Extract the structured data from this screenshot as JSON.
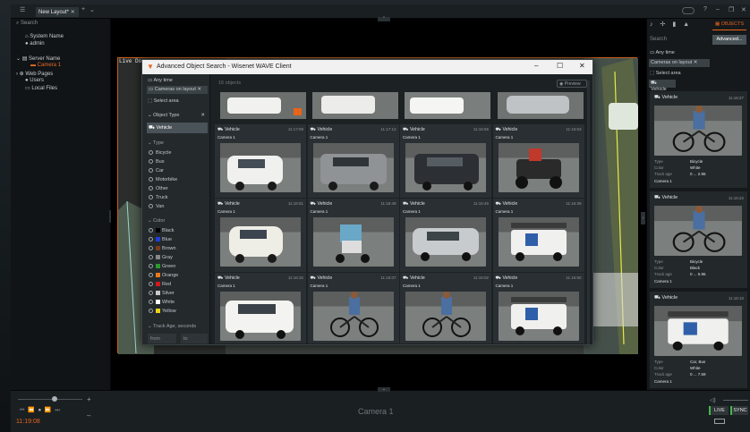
{
  "titlebar": {
    "tab_label": "New Layout*"
  },
  "tree": {
    "search_placeholder": "Search",
    "system_name": "System Name",
    "user": "admin",
    "server": "Server Name",
    "camera": "Camera 1",
    "web_pages": "Web Pages",
    "users": "Users",
    "local_files": "Local Files"
  },
  "scene": {
    "camera_label": "Live Do"
  },
  "dialog": {
    "title": "Advanced Object Search - Wisenet WAVE Client",
    "count": "16 objects",
    "preview": "Preview",
    "filters": {
      "any_time": "Any time",
      "cameras": "Cameras on layout",
      "select_area": "Select area",
      "object_type": "Object Type",
      "vehicle": "Vehicle",
      "type_heading": "Type",
      "types": [
        "Bicycle",
        "Bus",
        "Car",
        "Motorbike",
        "Other",
        "Truck",
        "Van"
      ],
      "color_heading": "Color",
      "colors": [
        {
          "label": "Black",
          "hex": "#000000"
        },
        {
          "label": "Blue",
          "hex": "#1f3fd6"
        },
        {
          "label": "Brown",
          "hex": "#7a3a1c"
        },
        {
          "label": "Gray",
          "hex": "#888888"
        },
        {
          "label": "Green",
          "hex": "#2a9a30"
        },
        {
          "label": "Orange",
          "hex": "#e87a1a"
        },
        {
          "label": "Red",
          "hex": "#d21a1a"
        },
        {
          "label": "Silver",
          "hex": "#c9c9c9"
        },
        {
          "label": "White",
          "hex": "#ffffff"
        },
        {
          "label": "Yellow",
          "hex": "#e8d21a"
        }
      ],
      "track_age": "Track Age, seconds",
      "from": "from",
      "to": "to"
    },
    "results": [
      {
        "label": "Vehicle",
        "time": "11:17:09",
        "camera": "Camera 1",
        "kind": "white-car"
      },
      {
        "label": "Vehicle",
        "time": "11:17:13",
        "camera": "Camera 1",
        "kind": "gray-suv"
      },
      {
        "label": "Vehicle",
        "time": "11:16:55",
        "camera": "Camera 1",
        "kind": "black-suv"
      },
      {
        "label": "Vehicle",
        "time": "11:16:53",
        "camera": "Camera 1",
        "kind": "atv"
      },
      {
        "label": "Vehicle",
        "time": "11:16:51",
        "camera": "Camera 1",
        "kind": "white-small-car"
      },
      {
        "label": "Vehicle",
        "time": "11:16:49",
        "camera": "Camera 1",
        "kind": "scooter"
      },
      {
        "label": "Vehicle",
        "time": "11:16:45",
        "camera": "Camera 1",
        "kind": "silver-car"
      },
      {
        "label": "Vehicle",
        "time": "11:16:39",
        "camera": "Camera 1",
        "kind": "cart"
      },
      {
        "label": "Vehicle",
        "time": "11:16:32",
        "camera": "Camera 1",
        "kind": "white-suv"
      },
      {
        "label": "Vehicle",
        "time": "11:16:07",
        "camera": "Camera 1",
        "kind": "bicycle"
      },
      {
        "label": "Vehicle",
        "time": "11:16:02",
        "camera": "Camera 1",
        "kind": "bicycle"
      },
      {
        "label": "Vehicle",
        "time": "11:15:50",
        "camera": "Camera 1",
        "kind": "cart"
      }
    ]
  },
  "right_panel": {
    "tab_objects": "OBJECTS",
    "search_placeholder": "Search",
    "advanced": "Advanced...",
    "any_time": "Any time",
    "cameras": "Cameras on layout",
    "select_area": "Select area",
    "filter_chip": "Vehicle",
    "cards": [
      {
        "label": "Vehicle",
        "time": "11:16:27",
        "type_key": "Type",
        "type": "Bicycle",
        "color_key": "Color",
        "color": "White",
        "age_key": "Track age",
        "age": "0 ... 2.96",
        "camera": "Camera 1"
      },
      {
        "label": "Vehicle",
        "time": "11:16:22",
        "type_key": "Type",
        "type": "Bicycle",
        "color_key": "Color",
        "color": "Black",
        "age_key": "Track age",
        "age": "0 ... 5.96",
        "camera": "Camera 1"
      },
      {
        "label": "Vehicle",
        "time": "11:16:10",
        "type_key": "Type",
        "type": "Car, Bus",
        "color_key": "Color",
        "color": "White",
        "age_key": "Track age",
        "age": "0 ... 7.59",
        "camera": "Camera 1"
      }
    ]
  },
  "bottom": {
    "time": "11:19:08",
    "camera": "Camera 1",
    "live": "LIVE",
    "sync": "SYNC"
  }
}
